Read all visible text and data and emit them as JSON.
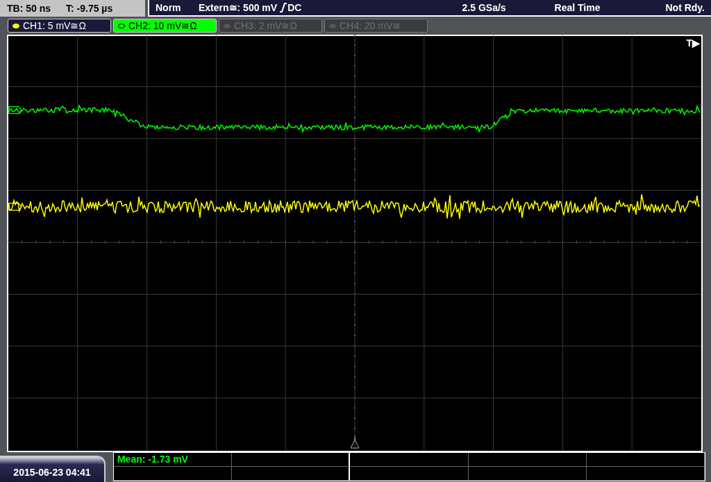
{
  "timebase": {
    "tb": "TB: 50 ns",
    "t": "T: -9.75 µs"
  },
  "trigger": {
    "mode": "Norm",
    "source": "Extern≅: 500 mV",
    "coupling": "DC"
  },
  "sample_rate": "2.5 GSa/s",
  "acquisition": "Real Time",
  "status": "Not Rdy.",
  "channels": [
    {
      "label": "CH1: 5 mV≅Ω",
      "on": true,
      "selected": false,
      "color": "#ffff00"
    },
    {
      "label": "CH2: 10 mV≅Ω",
      "on": true,
      "selected": true,
      "color": "#00ff00"
    },
    {
      "label": "CH3: 2 mV≅Ω",
      "on": false,
      "selected": false
    },
    {
      "label": "CH4: 20 mV≅",
      "on": false,
      "selected": false
    }
  ],
  "plot": {
    "trigger_label": "T▶"
  },
  "measurements": [
    {
      "text": "Mean: -1.73 mV"
    }
  ],
  "date": "2015-06-23 04:41"
}
